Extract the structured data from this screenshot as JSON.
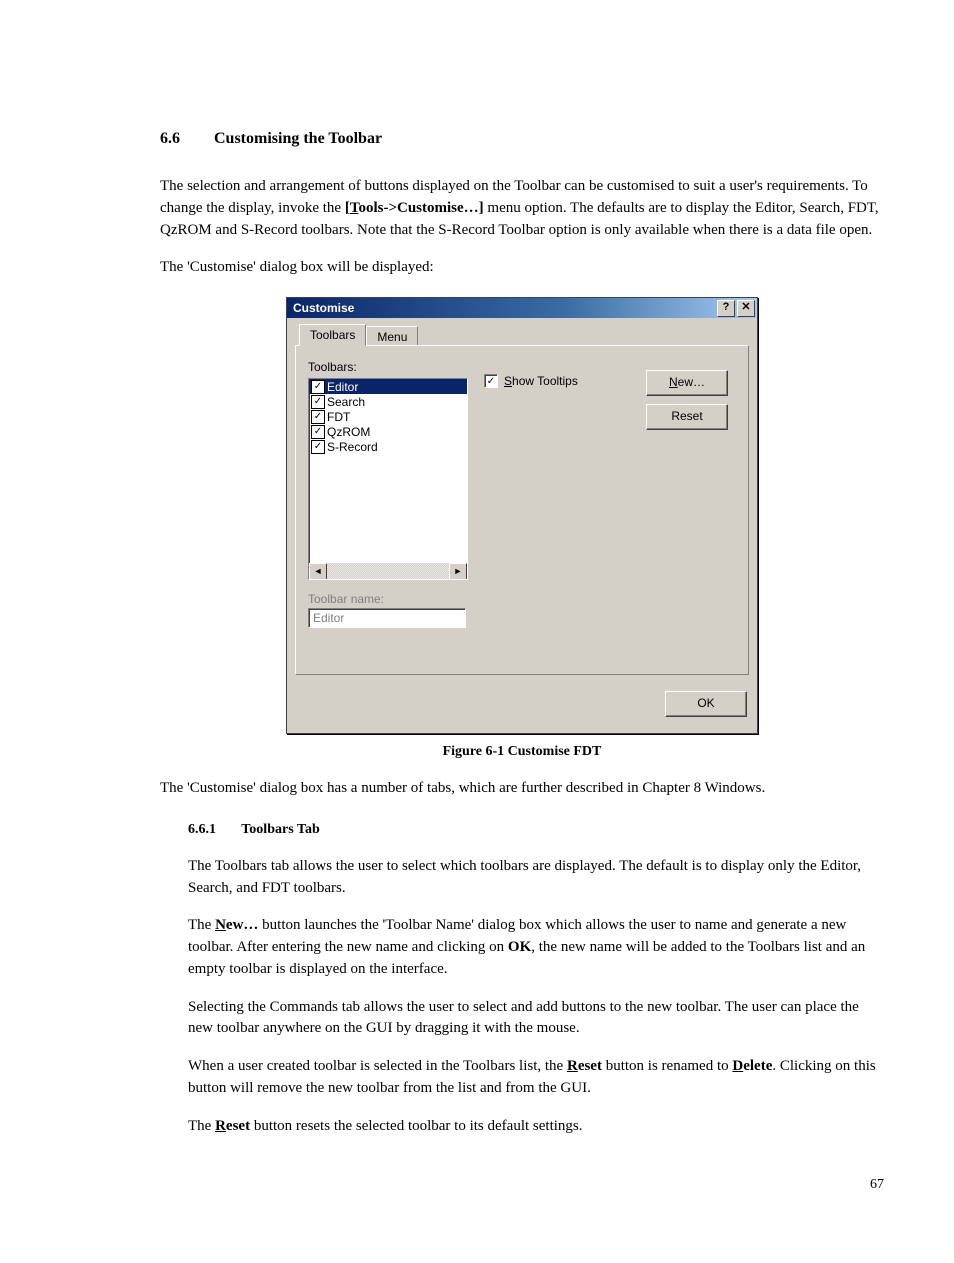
{
  "heading": {
    "number": "6.6",
    "title": "Customising the Toolbar"
  },
  "intro": {
    "p1a": "The selection and arrangement of buttons displayed on the Toolbar can be customised to suit a user's requirements. To change the display, invoke the ",
    "menu_ref_open": "[",
    "menu_ref_u": "T",
    "menu_ref_rest": "ools->Customise…]",
    "p1b": " menu option. The defaults are to display the Editor, Search, FDT, QzROM and S-Record toolbars. Note that the S-Record Toolbar option is only available when there is a data file open.",
    "p2": "The 'Customise' dialog box will be displayed:"
  },
  "dialog": {
    "title": "Customise",
    "help_btn": "?",
    "close_btn": "✕",
    "tabs": {
      "active": "Toolbars",
      "inactive": "Menu"
    },
    "list_label": "Toolbars:",
    "items": [
      {
        "label": "Editor",
        "checked": true,
        "selected": true
      },
      {
        "label": "Search",
        "checked": true,
        "selected": false
      },
      {
        "label": "FDT",
        "checked": true,
        "selected": false
      },
      {
        "label": "QzROM",
        "checked": true,
        "selected": false
      },
      {
        "label": "S-Record",
        "checked": true,
        "selected": false
      }
    ],
    "show_tooltips_u": "S",
    "show_tooltips_rest": "how Tooltips",
    "show_tooltips_checked": true,
    "new_btn_u": "N",
    "new_btn_rest": "ew…",
    "reset_btn": "Reset",
    "name_label": "Toolbar name:",
    "name_value": "Editor",
    "ok_btn": "OK"
  },
  "caption": "Figure 6-1 Customise FDT",
  "after_caption": "The 'Customise' dialog box has a number of tabs, which are further described in Chapter 8   Windows.",
  "sub": {
    "number": "6.6.1",
    "title": "Toolbars Tab",
    "p1": "The Toolbars tab allows the user to select which toolbars are displayed. The default is to display only the Editor, Search, and FDT toolbars.",
    "p2a": "The ",
    "p2_new_u": "N",
    "p2_new_rest": "ew…",
    "p2b": " button launches the 'Toolbar Name' dialog box which allows the user to name and generate a new toolbar. After entering the new name and clicking on ",
    "p2_ok": "OK",
    "p2c": ", the new name will be added to the Toolbars list and an empty toolbar is displayed on the interface.",
    "p3": "Selecting the Commands tab allows the user to select and add buttons to the new toolbar. The user can place the new toolbar anywhere on the GUI by dragging it with the mouse.",
    "p4a": "When a user created toolbar is selected in the Toolbars list, the ",
    "p4_reset_u": "R",
    "p4_reset_rest": "eset",
    "p4b": " button is renamed to ",
    "p4_delete_u": "D",
    "p4_delete_rest": "elete",
    "p4c": ". Clicking on this button will remove the new toolbar from the list and from the GUI.",
    "p5a": "The ",
    "p5_reset_u": "R",
    "p5_reset_rest": "eset",
    "p5b": " button resets the selected toolbar to its default settings."
  },
  "page_number": "67"
}
